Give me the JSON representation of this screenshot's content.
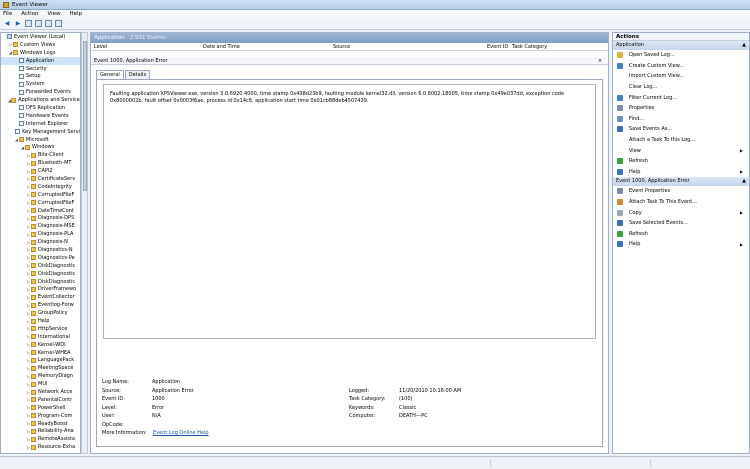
{
  "window": {
    "title": "Event Viewer"
  },
  "menu": [
    "File",
    "Action",
    "View",
    "Help"
  ],
  "toolbar_icons": [
    "back-icon",
    "forward-icon",
    "up-folder-icon",
    "help-icon",
    "properties-icon",
    "show-pane-icon"
  ],
  "tree": [
    {
      "label": "Event Viewer (Local)",
      "indent": 0,
      "exp": "",
      "icon": "view"
    },
    {
      "label": "Custom Views",
      "indent": 1,
      "exp": "▷",
      "icon": "folder"
    },
    {
      "label": "Windows Logs",
      "indent": 1,
      "exp": "◢",
      "icon": "folder"
    },
    {
      "label": "Application",
      "indent": 2,
      "exp": "",
      "icon": "log",
      "selected": true
    },
    {
      "label": "Security",
      "indent": 2,
      "exp": "",
      "icon": "log"
    },
    {
      "label": "Setup",
      "indent": 2,
      "exp": "",
      "icon": "log"
    },
    {
      "label": "System",
      "indent": 2,
      "exp": "",
      "icon": "log"
    },
    {
      "label": "Forwarded Events",
      "indent": 2,
      "exp": "",
      "icon": "log"
    },
    {
      "label": "Applications and Services",
      "indent": 1,
      "exp": "◢",
      "icon": "folder"
    },
    {
      "label": "DFS Replication",
      "indent": 2,
      "exp": "",
      "icon": "log"
    },
    {
      "label": "Hardware Events",
      "indent": 2,
      "exp": "",
      "icon": "log"
    },
    {
      "label": "Internet Explorer",
      "indent": 2,
      "exp": "",
      "icon": "log"
    },
    {
      "label": "Key Management Servi",
      "indent": 2,
      "exp": "",
      "icon": "log"
    },
    {
      "label": "Microsoft",
      "indent": 2,
      "exp": "◢",
      "icon": "folder"
    },
    {
      "label": "Windows",
      "indent": 3,
      "exp": "◢",
      "icon": "folder"
    },
    {
      "label": "Bits-Client",
      "indent": 4,
      "exp": "▷",
      "icon": "folder"
    },
    {
      "label": "Bluetooth-MT",
      "indent": 4,
      "exp": "▷",
      "icon": "folder"
    },
    {
      "label": "CAPI2",
      "indent": 4,
      "exp": "▷",
      "icon": "folder"
    },
    {
      "label": "CertificateServ",
      "indent": 4,
      "exp": "▷",
      "icon": "folder"
    },
    {
      "label": "CodeIntegrity",
      "indent": 4,
      "exp": "▷",
      "icon": "folder"
    },
    {
      "label": "CorruptedFileF",
      "indent": 4,
      "exp": "▷",
      "icon": "folder"
    },
    {
      "label": "CorruptedFileF",
      "indent": 4,
      "exp": "▷",
      "icon": "folder"
    },
    {
      "label": "DateTimeCont",
      "indent": 4,
      "exp": "▷",
      "icon": "folder"
    },
    {
      "label": "Diagnosis-DPS",
      "indent": 4,
      "exp": "▷",
      "icon": "folder"
    },
    {
      "label": "Diagnosis-MSE",
      "indent": 4,
      "exp": "▷",
      "icon": "folder"
    },
    {
      "label": "Diagnosis-PLA",
      "indent": 4,
      "exp": "▷",
      "icon": "folder"
    },
    {
      "label": "Diagnosis-N",
      "indent": 4,
      "exp": "▷",
      "icon": "folder"
    },
    {
      "label": "Diagnostics-N",
      "indent": 4,
      "exp": "▷",
      "icon": "folder"
    },
    {
      "label": "Diagnostics-Pe",
      "indent": 4,
      "exp": "▷",
      "icon": "folder"
    },
    {
      "label": "DiskDiagnostic",
      "indent": 4,
      "exp": "▷",
      "icon": "folder"
    },
    {
      "label": "DiskDiagnostic",
      "indent": 4,
      "exp": "▷",
      "icon": "folder"
    },
    {
      "label": "DiskDiagnostic",
      "indent": 4,
      "exp": "▷",
      "icon": "folder"
    },
    {
      "label": "DriverFramewo",
      "indent": 4,
      "exp": "▷",
      "icon": "folder"
    },
    {
      "label": "EventCollector",
      "indent": 4,
      "exp": "▷",
      "icon": "folder"
    },
    {
      "label": "Eventlog-Forw",
      "indent": 4,
      "exp": "▷",
      "icon": "folder"
    },
    {
      "label": "GroupPolicy",
      "indent": 4,
      "exp": "▷",
      "icon": "folder"
    },
    {
      "label": "Help",
      "indent": 4,
      "exp": "▷",
      "icon": "folder"
    },
    {
      "label": "HttpService",
      "indent": 4,
      "exp": "▷",
      "icon": "folder"
    },
    {
      "label": "International",
      "indent": 4,
      "exp": "▷",
      "icon": "folder"
    },
    {
      "label": "Kernel-WDI",
      "indent": 4,
      "exp": "▷",
      "icon": "folder"
    },
    {
      "label": "Kernel-WHEA",
      "indent": 4,
      "exp": "▷",
      "icon": "folder"
    },
    {
      "label": "LanguagePack",
      "indent": 4,
      "exp": "▷",
      "icon": "folder"
    },
    {
      "label": "MeetingSpace",
      "indent": 4,
      "exp": "▷",
      "icon": "folder"
    },
    {
      "label": "MemoryDiagn",
      "indent": 4,
      "exp": "▷",
      "icon": "folder"
    },
    {
      "label": "MUI",
      "indent": 4,
      "exp": "▷",
      "icon": "folder"
    },
    {
      "label": "Network Acce",
      "indent": 4,
      "exp": "▷",
      "icon": "folder"
    },
    {
      "label": "ParentalContr",
      "indent": 4,
      "exp": "▷",
      "icon": "folder"
    },
    {
      "label": "PowerShell",
      "indent": 4,
      "exp": "▷",
      "icon": "folder"
    },
    {
      "label": "Program-Com",
      "indent": 4,
      "exp": "▷",
      "icon": "folder"
    },
    {
      "label": "ReadyBoost",
      "indent": 4,
      "exp": "▷",
      "icon": "folder"
    },
    {
      "label": "Reliability-Ana",
      "indent": 4,
      "exp": "▷",
      "icon": "folder"
    },
    {
      "label": "RemoteAssista",
      "indent": 4,
      "exp": "▷",
      "icon": "folder"
    },
    {
      "label": "Resource-Exha",
      "indent": 4,
      "exp": "▷",
      "icon": "folder"
    }
  ],
  "center": {
    "log_name": "Application",
    "event_count": "2,931 Events",
    "columns": [
      "Level",
      "Date and Time",
      "Source",
      "Event ID",
      "Task Category"
    ],
    "detail_title": "Event 1000, Application Error",
    "close_label": "×",
    "tabs": [
      "General",
      "Details"
    ],
    "message": "Faulting application XPSViewer.exe, version 3.0.6920.4000, time stamp 0x498d23b9, faulting module kernel32.dll, version 6.0.6002.18005, time stamp 0x49e037dd, exception code 0x8000002b, fault offset 0x0003f6ae, process id 0x14c8, application start time 0x01cb88deb4507439.",
    "fields_left": [
      {
        "k": "Log Name:",
        "v": "Application"
      },
      {
        "k": "Source:",
        "v": "Application Error"
      },
      {
        "k": "Event ID:",
        "v": "1000"
      },
      {
        "k": "Level:",
        "v": "Error"
      },
      {
        "k": "User:",
        "v": "N/A"
      },
      {
        "k": "OpCode:",
        "v": ""
      },
      {
        "k": "More Information:",
        "v": "Event Log Online Help"
      }
    ],
    "fields_right": [
      {
        "k": "Logged:",
        "v": "11/20/2010 10:16:00 AM"
      },
      {
        "k": "Task Category:",
        "v": "(100)"
      },
      {
        "k": "Keywords:",
        "v": "Classic"
      },
      {
        "k": "Computer:",
        "v": "DEATH---PC"
      }
    ]
  },
  "actions": {
    "title": "Actions",
    "section1": "Application",
    "section1_items": [
      {
        "label": "Open Saved Log...",
        "icon": "folder-open-icon",
        "color": "#e0b040"
      },
      {
        "label": "Create Custom View...",
        "icon": "filter-icon",
        "color": "#4a7fc0"
      },
      {
        "label": "Import Custom View...",
        "icon": "",
        "color": ""
      },
      {
        "label": "Clear Log...",
        "icon": "",
        "color": ""
      },
      {
        "label": "Filter Current Log...",
        "icon": "filter-icon",
        "color": "#4a7fc0"
      },
      {
        "label": "Properties",
        "icon": "properties-icon",
        "color": "#7a8ca8"
      },
      {
        "label": "Find...",
        "icon": "find-icon",
        "color": "#6a90c8"
      },
      {
        "label": "Save Events As...",
        "icon": "save-icon",
        "color": "#4070b0"
      },
      {
        "label": "Attach a Task To this Log...",
        "icon": "",
        "color": ""
      },
      {
        "label": "View",
        "icon": "",
        "color": "",
        "submenu": true
      },
      {
        "label": "Refresh",
        "icon": "refresh-icon",
        "color": "#3aa040"
      },
      {
        "label": "Help",
        "icon": "help-icon",
        "color": "#3a70c8",
        "submenu": true
      }
    ],
    "section2": "Event 1000, Application Error",
    "section2_items": [
      {
        "label": "Event Properties",
        "icon": "properties-icon",
        "color": "#7a8ca8"
      },
      {
        "label": "Attach Task To This Event...",
        "icon": "task-icon",
        "color": "#c89030"
      },
      {
        "label": "Copy",
        "icon": "copy-icon",
        "color": "#9aa8ba",
        "submenu": true
      },
      {
        "label": "Save Selected Events...",
        "icon": "save-icon",
        "color": "#4070b0"
      },
      {
        "label": "Refresh",
        "icon": "refresh-icon",
        "color": "#3aa040"
      },
      {
        "label": "Help",
        "icon": "help-icon",
        "color": "#3a70c8",
        "submenu": true
      }
    ]
  }
}
